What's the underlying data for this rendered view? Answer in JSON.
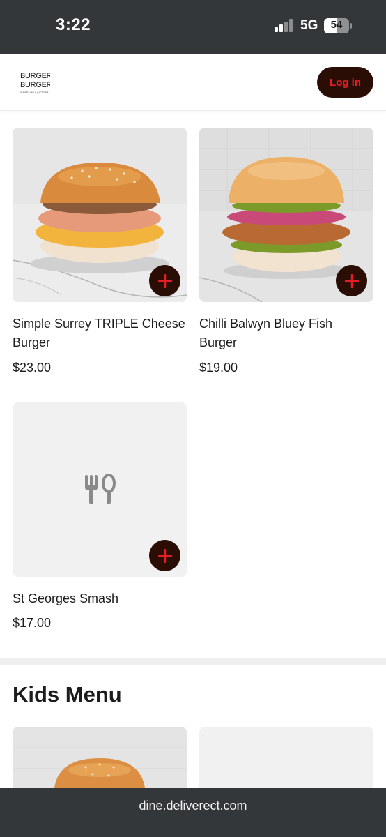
{
  "status_bar": {
    "time": "3:22",
    "network": "5G",
    "battery": "54",
    "battery_level": 0.54
  },
  "header": {
    "logo_line1": "BURGER",
    "logo_line2": "BURGER",
    "logo_tagline": "SURREY HILLS | VICTORIA",
    "login_label": "Log in"
  },
  "items": [
    {
      "name": "Simple Surrey TRIPLE Cheese Burger",
      "price": "$23.00",
      "image": "cheese-burger-photo"
    },
    {
      "name": "Chilli Balwyn Bluey Fish Burger",
      "price": "$19.00",
      "image": "fish-burger-photo"
    },
    {
      "name": "St Georges Smash",
      "price": "$17.00",
      "image": "cutlery-placeholder"
    }
  ],
  "sections": [
    {
      "title": "Kids Menu"
    }
  ],
  "colors": {
    "brand_dark": "#2a0e06",
    "accent_red": "#e41e24",
    "system_bar": "#34373a"
  },
  "browser": {
    "url": "dine.deliverect.com"
  }
}
